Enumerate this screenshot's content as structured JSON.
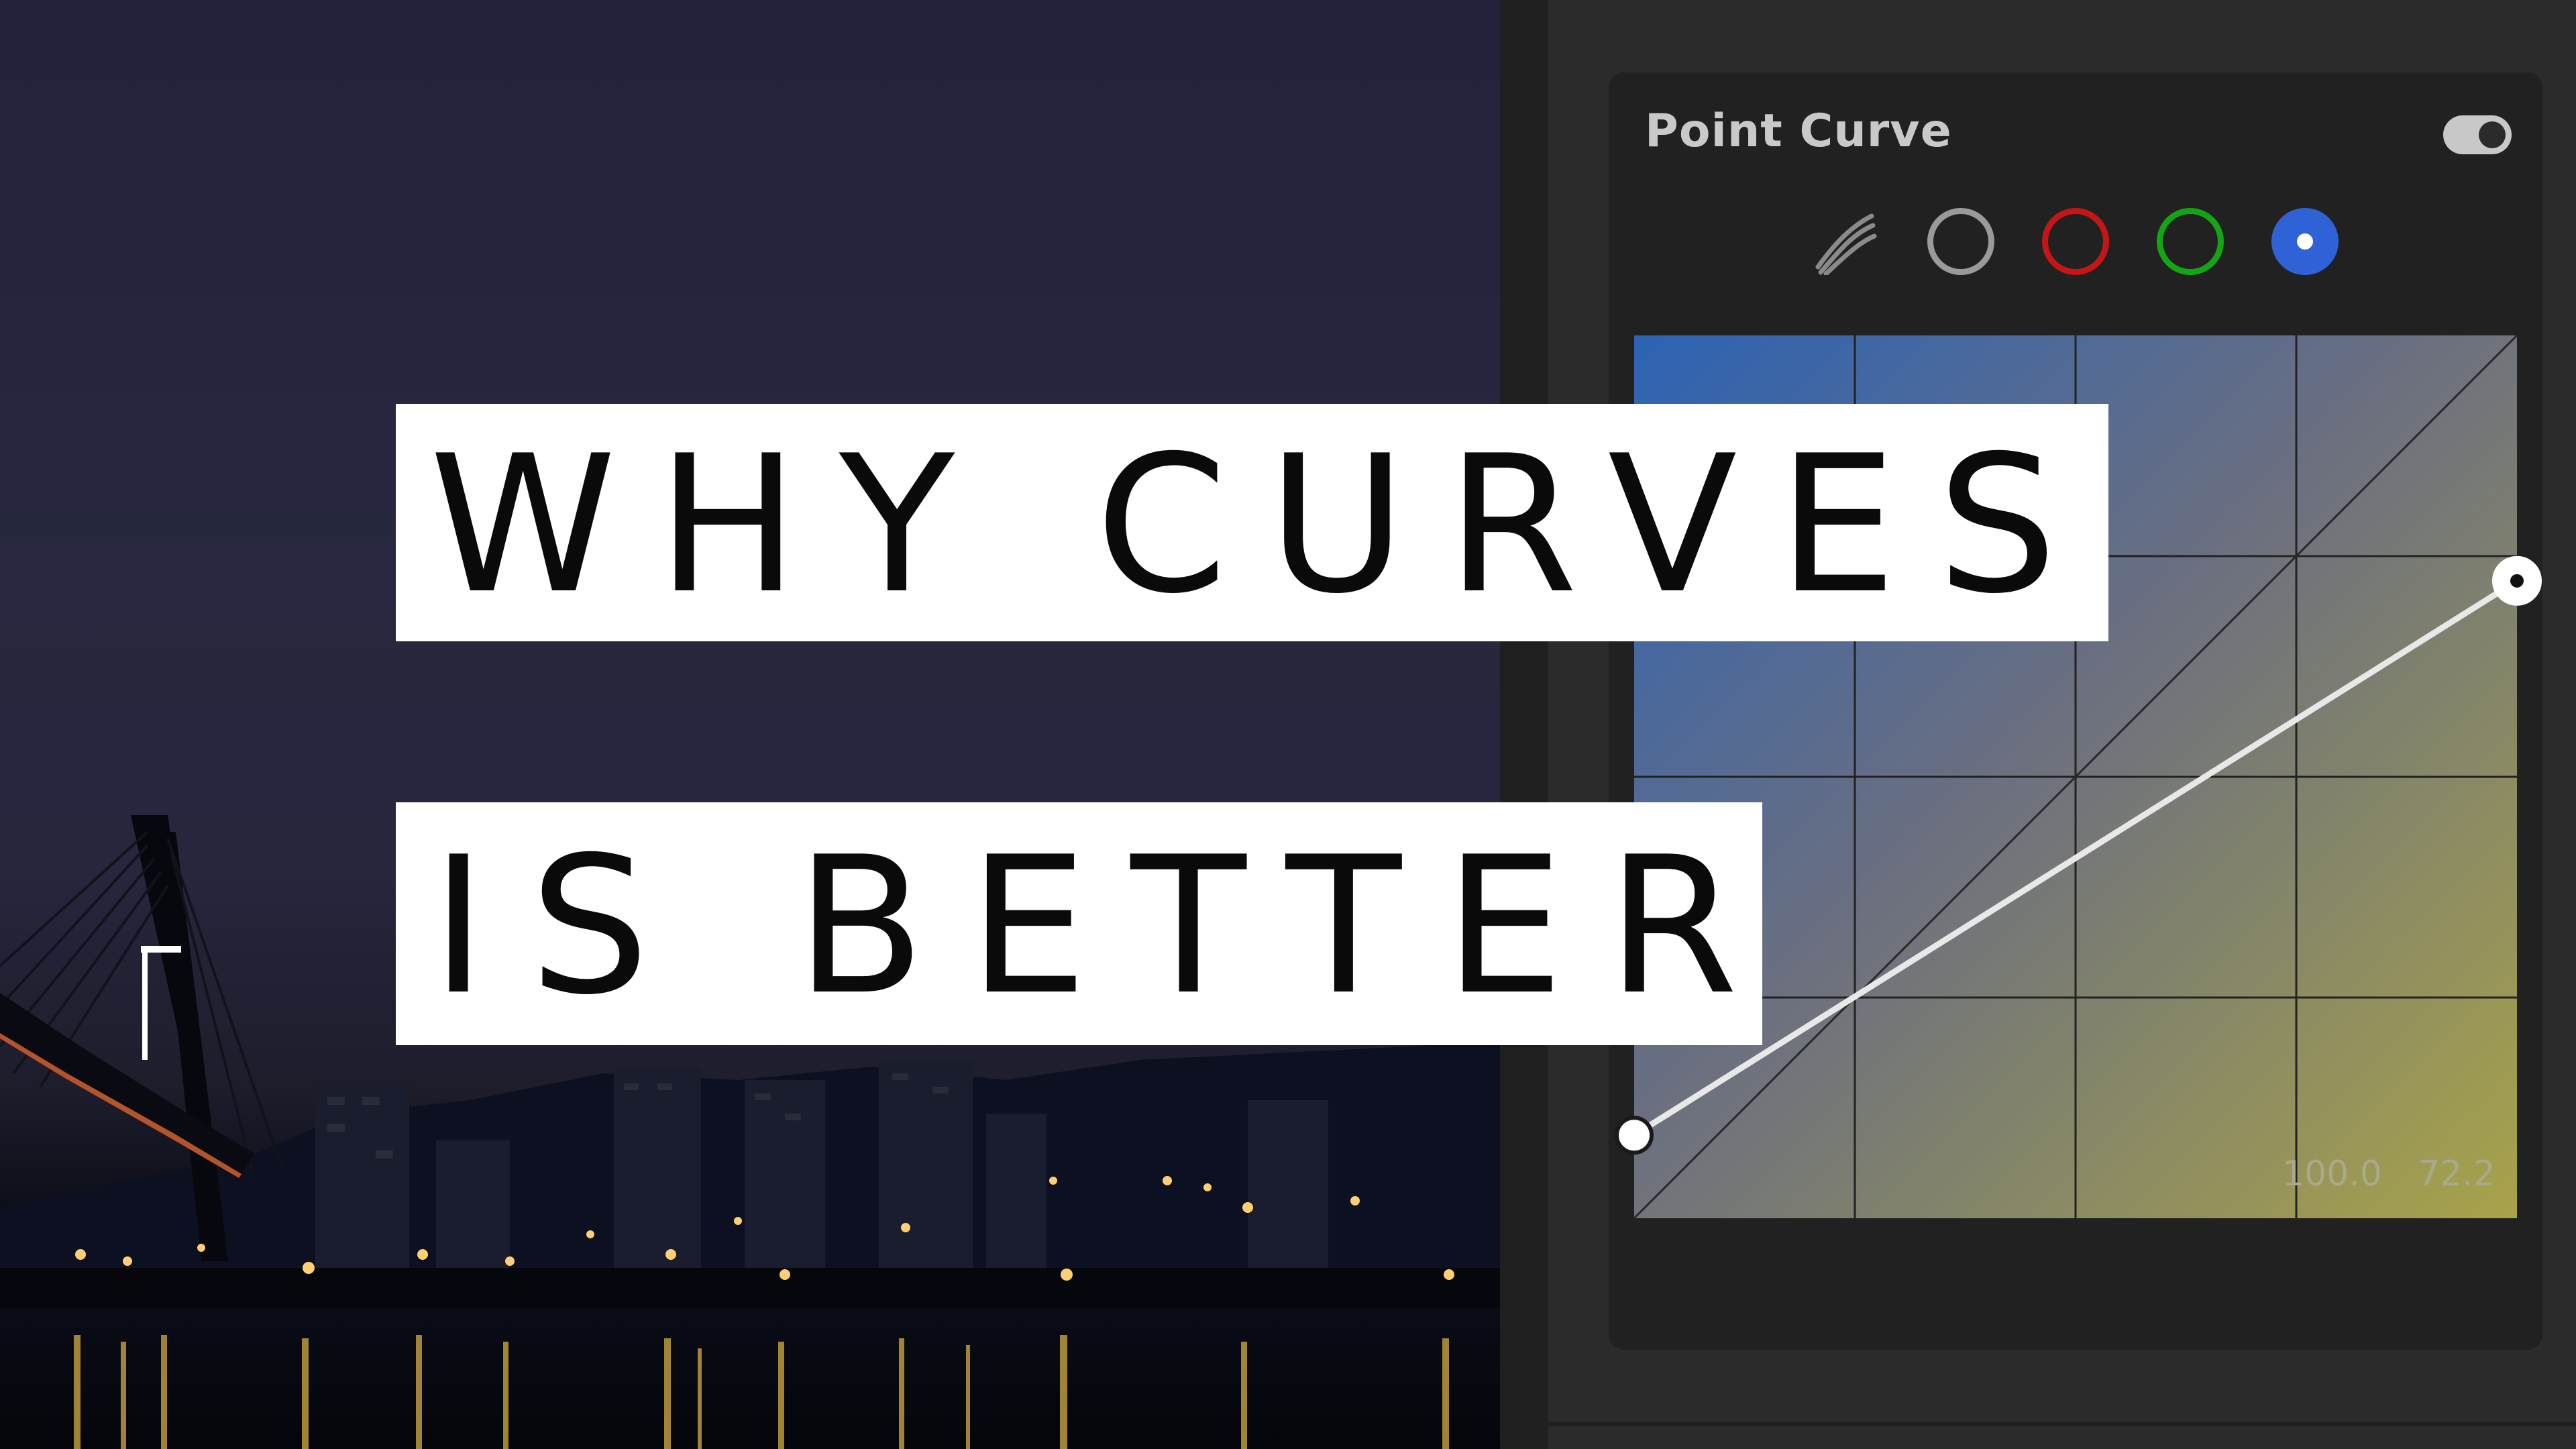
{
  "headline": {
    "line1": "WHY CURVES",
    "line2": "IS BETTER"
  },
  "point_curve": {
    "title": "Point Curve",
    "enabled": true,
    "channels": [
      {
        "name": "parametric",
        "icon": "parametric-curve-icon",
        "selected": false
      },
      {
        "name": "rgb",
        "color": "#9a9a9a",
        "selected": false
      },
      {
        "name": "red",
        "color": "#c41616",
        "selected": false
      },
      {
        "name": "green",
        "color": "#14a514",
        "selected": false
      },
      {
        "name": "blue",
        "color": "#2f62d6",
        "selected": true
      }
    ],
    "readout": {
      "input": "100.0",
      "output": "72.2"
    },
    "points": [
      {
        "input": 0,
        "output": 9.4
      },
      {
        "input": 100,
        "output": 72.2
      }
    ],
    "grid_divisions": 4
  },
  "colors": {
    "panel": "#2b2b2b",
    "card": "#212121",
    "curve_line": "#e8e8e8",
    "blue_accent": "#2f62d6"
  }
}
